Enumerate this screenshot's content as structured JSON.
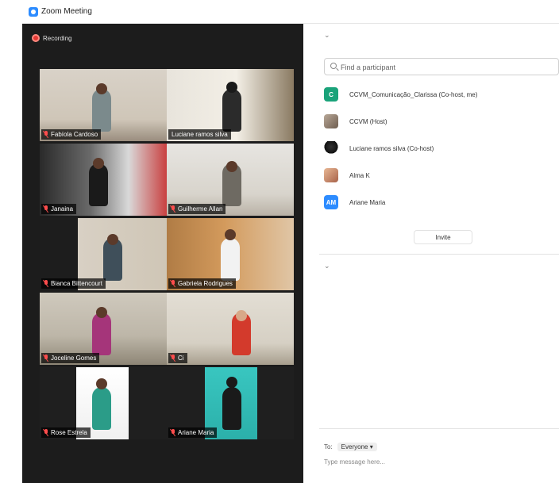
{
  "window": {
    "title": "Zoom Meeting"
  },
  "recording": {
    "label": "Recording"
  },
  "video_tiles": [
    {
      "name": "Fabíola Cardoso",
      "muted": true,
      "active": false
    },
    {
      "name": "Luciane ramos silva",
      "muted": false,
      "active": true
    },
    {
      "name": "Janaina",
      "muted": true,
      "active": false
    },
    {
      "name": "Guilherme Allan",
      "muted": true,
      "active": false
    },
    {
      "name": "Bianca Bittencourt",
      "muted": true,
      "active": false
    },
    {
      "name": "Gabriela Rodrigues",
      "muted": true,
      "active": false
    },
    {
      "name": "Joceline Gomes",
      "muted": true,
      "active": false
    },
    {
      "name": "Ci",
      "muted": true,
      "active": false
    },
    {
      "name": "Rose Estrela",
      "muted": true,
      "active": false
    },
    {
      "name": "Ariane Maria",
      "muted": true,
      "active": false
    }
  ],
  "participants_panel": {
    "search_placeholder": "Find a participant",
    "participants": [
      {
        "name": "CCVM_Comunicação_Clarissa (Co-host, me)",
        "avatar_type": "letter",
        "avatar_text": "C",
        "avatar_color": "#1aa37a"
      },
      {
        "name": "CCVM (Host)",
        "avatar_type": "photo",
        "avatar_text": "",
        "avatar_color": "#8a7a6c"
      },
      {
        "name": "Luciane ramos silva (Co-host)",
        "avatar_type": "photo",
        "avatar_text": "",
        "avatar_color": "#1f1f1f"
      },
      {
        "name": "Alma K",
        "avatar_type": "photo",
        "avatar_text": "",
        "avatar_color": "#c48a6a"
      },
      {
        "name": "Ariane Maria",
        "avatar_type": "letter",
        "avatar_text": "AM",
        "avatar_color": "#2d8cff"
      }
    ],
    "invite_label": "Invite"
  },
  "chat": {
    "to_label": "To:",
    "recipient": "Everyone ▾",
    "input_placeholder": "Type message here..."
  },
  "colors": {
    "accent": "#2d8cff",
    "active_speaker": "#c8e25f",
    "muted": "#ff4d4d"
  }
}
